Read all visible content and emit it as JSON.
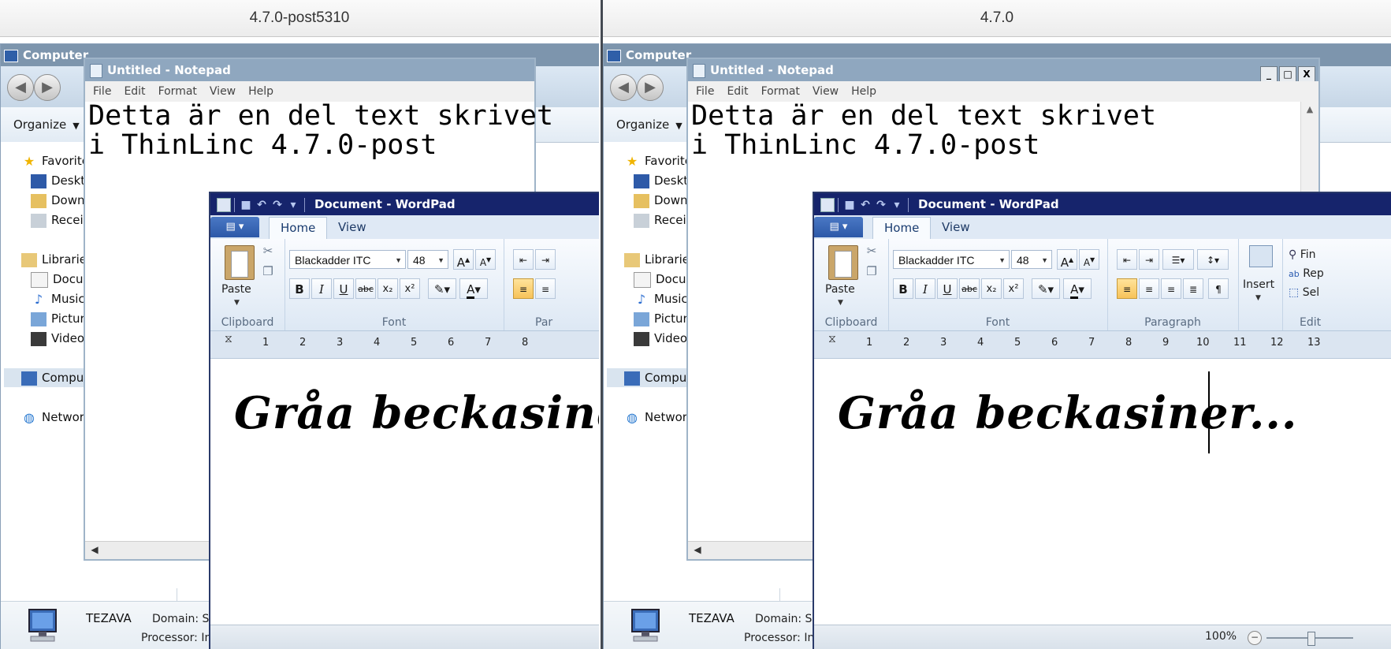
{
  "left_pane": {
    "label": "4.7.0-post5310",
    "explorer": {
      "title": "Computer",
      "organize": "Organize",
      "favorites": "Favorite",
      "desktop": "Deskt",
      "downloads": "Down",
      "recent": "Recei",
      "libraries": "Librarie",
      "documents": "Docur",
      "music": "Music",
      "pictures": "Pictur",
      "videos": "Video",
      "computer": "Comput",
      "network": "Networ",
      "computer_name": "TEZAVA",
      "domain": "Domain: S",
      "processor": "Processor: Intel(R) Pentium(R) CPU ..."
    },
    "notepad": {
      "title": "Untitled - Notepad",
      "menu": [
        "File",
        "Edit",
        "Format",
        "View",
        "Help"
      ],
      "text_line1": "Detta är en del text skrivet",
      "text_line2": "i ThinLinc 4.7.0-post"
    },
    "wordpad": {
      "title": "Document - WordPad",
      "tab_home": "Home",
      "tab_view": "View",
      "paste": "Paste",
      "font_name": "Blackadder ITC",
      "font_size": "48",
      "group_clipboard": "Clipboard",
      "group_font": "Font",
      "group_paragraph": "Par",
      "doc_text": "Gråa beckasiner"
    }
  },
  "right_pane": {
    "label": "4.7.0",
    "explorer": {
      "title": "Computer",
      "organize": "Organize",
      "favorites": "Favorite",
      "desktop": "Deskt",
      "downloads": "Down",
      "recent": "Recei",
      "libraries": "Librarie",
      "documents": "Docur",
      "music": "Music",
      "pictures": "Pictur",
      "videos": "Video",
      "computer": "Comput",
      "network": "Networ",
      "computer_name": "TEZAVA",
      "domain": "Domain: S",
      "processor": "Processor: Intel(R) Pentium(R) CPU ..."
    },
    "notepad": {
      "title": "Untitled - Notepad",
      "menu": [
        "File",
        "Edit",
        "Format",
        "View",
        "Help"
      ],
      "text_line1": "Detta är en del text skrivet",
      "text_line2": "i ThinLinc 4.7.0-post",
      "ctrl_min": "_",
      "ctrl_max": "□",
      "ctrl_close": "X"
    },
    "wordpad": {
      "title": "Document - WordPad",
      "tab_home": "Home",
      "tab_view": "View",
      "paste": "Paste",
      "font_name": "Blackadder ITC",
      "font_size": "48",
      "group_clipboard": "Clipboard",
      "group_font": "Font",
      "group_paragraph": "Paragraph",
      "insert": "Insert",
      "edit_find": "Fin",
      "edit_replace": "Rep",
      "edit_select": "Sel",
      "group_editing": "Edit",
      "doc_text": "Gråa beckasiner...",
      "zoom": "100%"
    }
  },
  "ruler_numbers": [
    "1",
    "2",
    "3",
    "4",
    "5",
    "6",
    "7",
    "8",
    "9",
    "10",
    "11",
    "12",
    "13"
  ],
  "icons": {
    "favorites": "star-icon",
    "desktop": "desktop-icon",
    "downloads": "downloads-folder-icon",
    "recent": "recent-places-icon",
    "libraries": "libraries-icon",
    "documents": "documents-icon",
    "music": "music-icon",
    "pictures": "pictures-icon",
    "videos": "videos-icon",
    "computer": "computer-icon",
    "network": "network-icon"
  },
  "colors": {
    "wordpad_title": "#16246c",
    "notepad_title": "#8fa7bf",
    "explorer_title": "#7d95ad",
    "active_align": "#f7c35a"
  }
}
